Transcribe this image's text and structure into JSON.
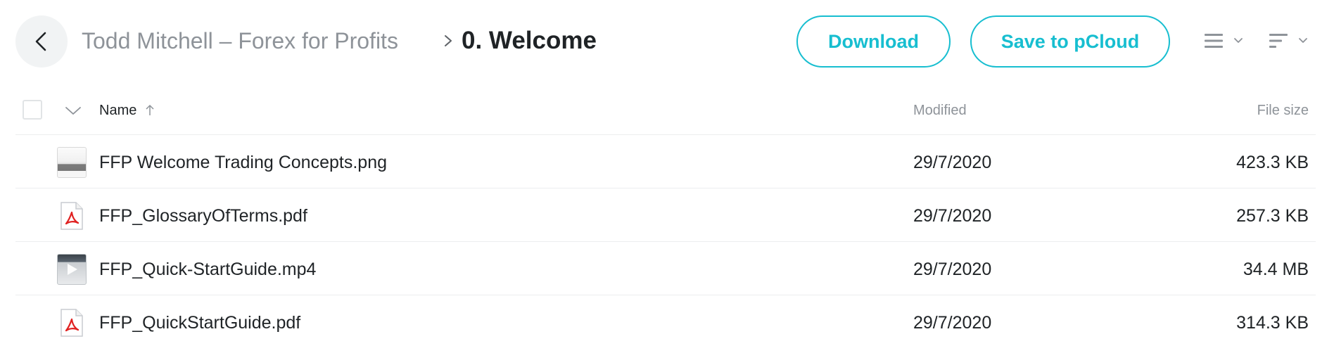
{
  "header": {
    "back_icon": "chevron-left-icon",
    "breadcrumb_parent": "Todd Mitchell – Forex for Profits",
    "breadcrumb_separator_icon": "chevron-right-icon",
    "breadcrumb_current": "0. Welcome",
    "download_label": "Download",
    "save_label": "Save to pCloud",
    "view_mode_icon": "list-view-icon",
    "sort_icon": "sort-lines-icon"
  },
  "table": {
    "columns": {
      "name": "Name",
      "modified": "Modified",
      "size": "File size"
    },
    "sort": {
      "column": "name",
      "direction": "ascending"
    },
    "rows": [
      {
        "icon": "png-thumbnail-icon",
        "name": "FFP Welcome Trading Concepts.png",
        "modified": "29/7/2020",
        "size": "423.3 KB"
      },
      {
        "icon": "pdf-file-icon",
        "name": "FFP_GlossaryOfTerms.pdf",
        "modified": "29/7/2020",
        "size": "257.3 KB"
      },
      {
        "icon": "video-thumbnail-icon",
        "name": "FFP_Quick-StartGuide.mp4",
        "modified": "29/7/2020",
        "size": "34.4 MB"
      },
      {
        "icon": "pdf-file-icon",
        "name": "FFP_QuickStartGuide.pdf",
        "modified": "29/7/2020",
        "size": "314.3 KB"
      }
    ]
  },
  "colors": {
    "accent": "#17bed0",
    "muted_text": "#8e9399",
    "primary_text": "#1f2326",
    "pdf_red": "#e02020"
  }
}
